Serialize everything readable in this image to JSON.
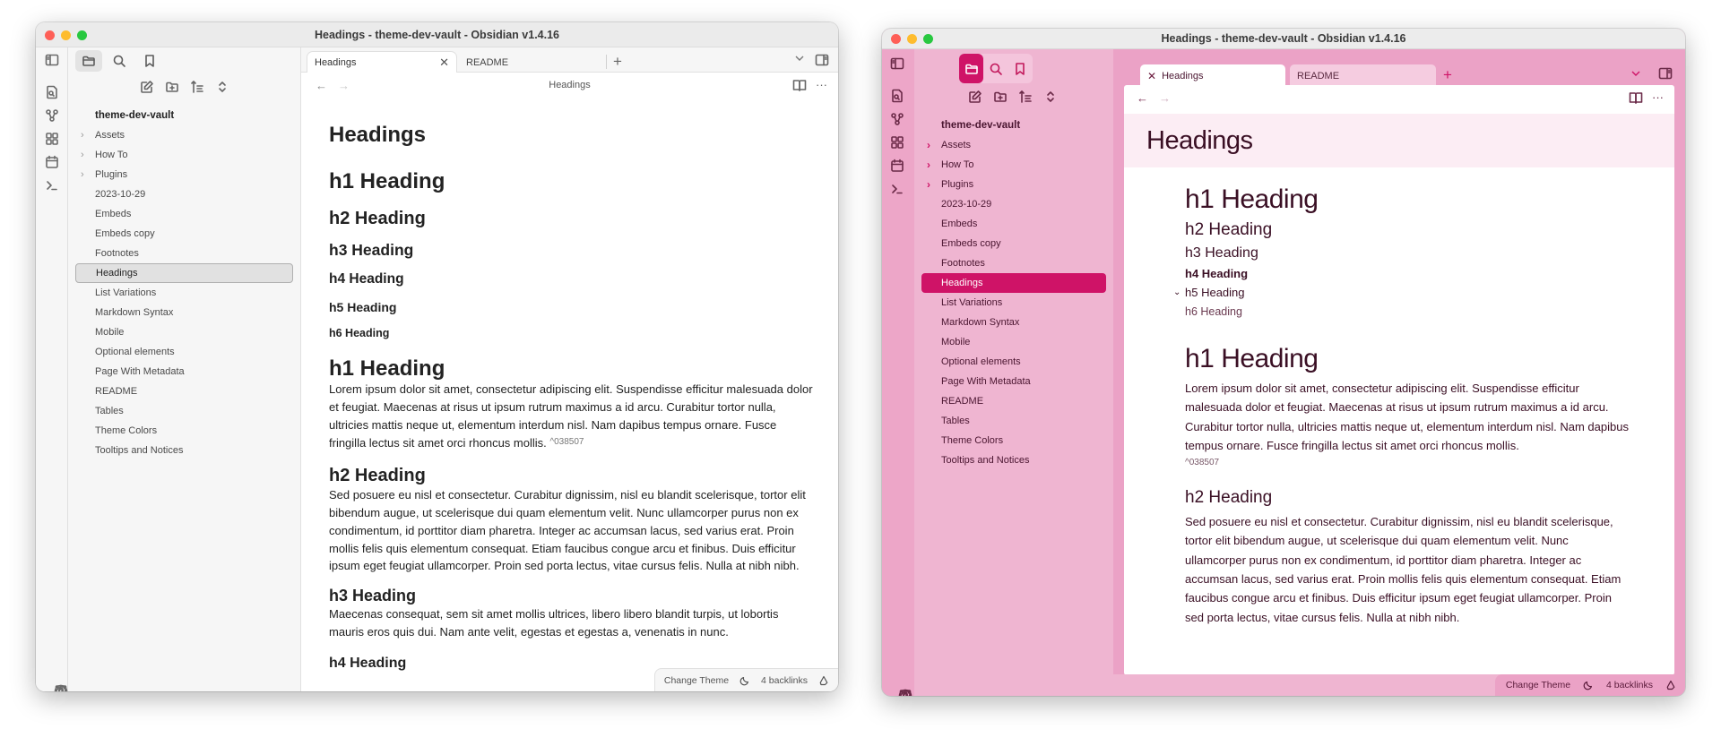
{
  "window_left": {
    "title": "Headings - theme-dev-vault - Obsidian v1.4.16",
    "tabs": [
      {
        "label": "Headings",
        "active": true
      },
      {
        "label": "README",
        "active": false
      }
    ],
    "view_title": "Headings",
    "sidebar": {
      "vault_name": "theme-dev-vault",
      "items": [
        {
          "label": "Assets",
          "folder": true
        },
        {
          "label": "How To",
          "folder": true
        },
        {
          "label": "Plugins",
          "folder": true
        },
        {
          "label": "2023-10-29"
        },
        {
          "label": "Embeds"
        },
        {
          "label": "Embeds copy"
        },
        {
          "label": "Footnotes"
        },
        {
          "label": "Headings",
          "active": true
        },
        {
          "label": "List Variations"
        },
        {
          "label": "Markdown Syntax"
        },
        {
          "label": "Mobile"
        },
        {
          "label": "Optional elements"
        },
        {
          "label": "Page With Metadata"
        },
        {
          "label": "README"
        },
        {
          "label": "Tables"
        },
        {
          "label": "Theme Colors"
        },
        {
          "label": "Tooltips and Notices"
        }
      ]
    },
    "document": {
      "title": "Headings",
      "headings": [
        "h1 Heading",
        "h2 Heading",
        "h3 Heading",
        "h4 Heading",
        "h5 Heading",
        "h6 Heading"
      ],
      "sections": [
        {
          "heading": "h1 Heading",
          "text": "Lorem ipsum dolor sit amet, consectetur adipiscing elit. Suspendisse efficitur malesuada dolor et feugiat. Maecenas at risus ut ipsum rutrum maximus a id arcu. Curabitur tortor nulla, ultricies mattis neque ut, elementum interdum nisl. Nam dapibus tempus ornare. Fusce fringilla lectus sit amet orci rhoncus mollis.",
          "block_id": "^038507"
        },
        {
          "heading": "h2 Heading",
          "text": "Sed posuere eu nisl et consectetur. Curabitur dignissim, nisl eu blandit scelerisque, tortor elit bibendum augue, ut scelerisque dui quam elementum velit. Nunc ullamcorper purus non ex condimentum, id porttitor diam pharetra. Integer ac accumsan lacus, sed varius erat. Proin mollis felis quis elementum consequat. Etiam faucibus congue arcu et finibus. Duis efficitur ipsum eget feugiat ullamcorper. Proin sed porta lectus, vitae cursus felis. Nulla at nibh nibh."
        },
        {
          "heading": "h3 Heading",
          "text": "Maecenas consequat, sem sit amet mollis ultrices, libero libero blandit turpis, ut lobortis mauris eros quis dui. Nam ante velit, egestas et egestas a, venenatis in nunc."
        },
        {
          "heading": "h4 Heading"
        }
      ]
    },
    "status": {
      "change_theme": "Change Theme",
      "backlinks": "4 backlinks"
    }
  },
  "window_right": {
    "title": "Headings - theme-dev-vault - Obsidian v1.4.16",
    "tabs": [
      {
        "label": "Headings",
        "active": true
      },
      {
        "label": "README",
        "active": false
      }
    ],
    "sidebar": {
      "vault_name": "theme-dev-vault",
      "items": [
        {
          "label": "Assets",
          "folder": true
        },
        {
          "label": "How To",
          "folder": true
        },
        {
          "label": "Plugins",
          "folder": true
        },
        {
          "label": "2023-10-29"
        },
        {
          "label": "Embeds"
        },
        {
          "label": "Embeds copy"
        },
        {
          "label": "Footnotes"
        },
        {
          "label": "Headings",
          "active": true
        },
        {
          "label": "List Variations"
        },
        {
          "label": "Markdown Syntax"
        },
        {
          "label": "Mobile"
        },
        {
          "label": "Optional elements"
        },
        {
          "label": "Page With Metadata"
        },
        {
          "label": "README"
        },
        {
          "label": "Tables"
        },
        {
          "label": "Theme Colors"
        },
        {
          "label": "Tooltips and Notices"
        }
      ]
    },
    "document": {
      "title": "Headings",
      "headings": [
        "h1 Heading",
        "h2 Heading",
        "h3 Heading",
        "h4 Heading",
        "h5 Heading",
        "h6 Heading"
      ],
      "sections": [
        {
          "heading": "h1 Heading",
          "text": "Lorem ipsum dolor sit amet, consectetur adipiscing elit. Suspendisse efficitur malesuada dolor et feugiat. Maecenas at risus ut ipsum rutrum maximus a id arcu. Curabitur tortor nulla, ultricies mattis neque ut, elementum interdum nisl. Nam dapibus tempus ornare. Fusce fringilla lectus sit amet orci rhoncus mollis.",
          "block_id": "^038507"
        },
        {
          "heading": "h2 Heading",
          "text": "Sed posuere eu nisl et consectetur. Curabitur dignissim, nisl eu blandit scelerisque, tortor elit bibendum augue, ut scelerisque dui quam elementum velit. Nunc ullamcorper purus non ex condimentum, id porttitor diam pharetra. Integer ac accumsan lacus, sed varius erat. Proin mollis felis quis elementum consequat. Etiam faucibus congue arcu et finibus. Duis efficitur ipsum eget feugiat ullamcorper. Proin sed porta lectus, vitae cursus felis. Nulla at nibh nibh."
        }
      ]
    },
    "status": {
      "change_theme": "Change Theme",
      "backlinks": "4 backlinks"
    },
    "colors": {
      "accent": "#cf1367",
      "background": "#eba2c6",
      "sidebar": "#efb5d1",
      "banner": "#fcedf4",
      "text": "#3a0f24"
    }
  },
  "icons": {
    "chevron_right": "›",
    "chevron_down": "⌄",
    "close": "✕",
    "plus": "+",
    "back": "←",
    "forward": "→",
    "more": "···",
    "dropdown": "⌄"
  }
}
